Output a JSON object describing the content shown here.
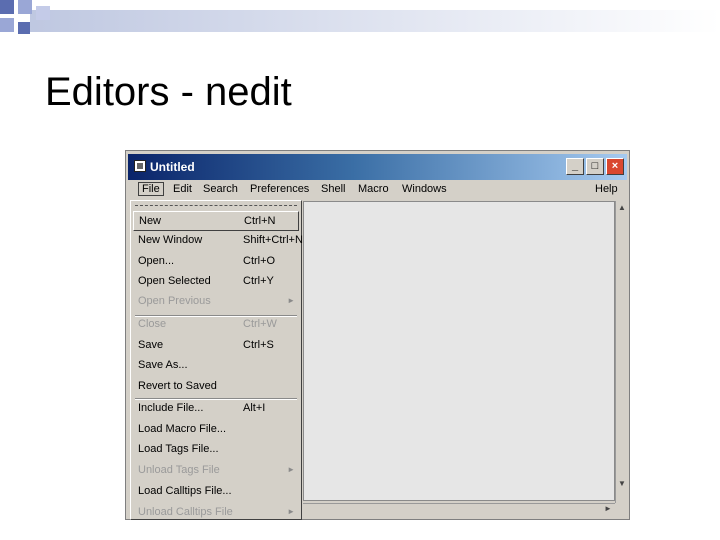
{
  "slide": {
    "title": "Editors - nedit"
  },
  "window": {
    "title": "Untitled"
  },
  "menubar": {
    "items": [
      "File",
      "Edit",
      "Search",
      "Preferences",
      "Shell",
      "Macro",
      "Windows",
      "Help"
    ]
  },
  "file_menu": {
    "items": [
      {
        "label": "New",
        "accel": "Ctrl+N",
        "state": "selected"
      },
      {
        "label": "New Window",
        "accel": "Shift+Ctrl+N",
        "state": "enabled"
      },
      {
        "label": "Open...",
        "accel": "Ctrl+O",
        "state": "enabled"
      },
      {
        "label": "Open Selected",
        "accel": "Ctrl+Y",
        "state": "enabled"
      },
      {
        "label": "Open Previous",
        "accel": "",
        "state": "disabled",
        "submenu": true
      },
      {
        "label": "Close",
        "accel": "Ctrl+W",
        "state": "disabled"
      },
      {
        "label": "Save",
        "accel": "Ctrl+S",
        "state": "enabled"
      },
      {
        "label": "Save As...",
        "accel": "",
        "state": "enabled"
      },
      {
        "label": "Revert to Saved",
        "accel": "",
        "state": "enabled"
      },
      {
        "label": "Include File...",
        "accel": "Alt+I",
        "state": "enabled"
      },
      {
        "label": "Load Macro File...",
        "accel": "",
        "state": "enabled"
      },
      {
        "label": "Load Tags File...",
        "accel": "",
        "state": "enabled"
      },
      {
        "label": "Unload Tags File",
        "accel": "",
        "state": "disabled",
        "submenu": true
      },
      {
        "label": "Load Calltips File...",
        "accel": "",
        "state": "enabled"
      },
      {
        "label": "Unload Calltips File",
        "accel": "",
        "state": "disabled",
        "submenu": true
      }
    ]
  },
  "icons": {
    "app": "nedit-app-icon",
    "minimize": "minimize-icon",
    "maximize": "maximize-icon",
    "close": "close-icon",
    "submenu": "submenu-arrow-icon",
    "scroll_up": "scroll-up-icon",
    "scroll_down": "scroll-down-icon",
    "scroll_right": "scroll-right-icon"
  },
  "colors": {
    "titlebar_start": "#0a246a",
    "titlebar_end": "#a6caf0",
    "close_button": "#d9472f"
  }
}
